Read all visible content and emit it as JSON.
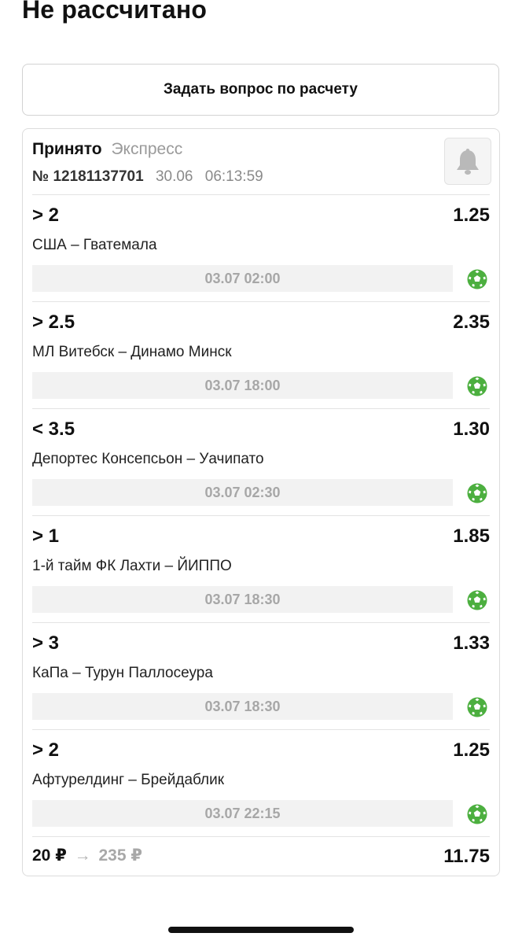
{
  "page_title": "Не рассчитано",
  "ask_button_label": "Задать вопрос по расчету",
  "bet": {
    "status": "Принято",
    "type": "Экспресс",
    "coupon_number": "№ 12181137701",
    "date": "30.06",
    "time": "06:13:59",
    "bell_icon": "bell-icon",
    "events": [
      {
        "outcome": "> 2",
        "odds": "1.25",
        "teams": "США – Гватемала",
        "start": "03.07 02:00",
        "sport_icon": "soccer-ball-icon"
      },
      {
        "outcome": "> 2.5",
        "odds": "2.35",
        "teams": "МЛ Витебск – Динамо Минск",
        "start": "03.07 18:00",
        "sport_icon": "soccer-ball-icon"
      },
      {
        "outcome": "< 3.5",
        "odds": "1.30",
        "teams": "Депортес Консепсьон – Уачипато",
        "start": "03.07 02:30",
        "sport_icon": "soccer-ball-icon"
      },
      {
        "outcome": "> 1",
        "odds": "1.85",
        "teams": "1-й тайм ФК Лахти – ЙИППО",
        "start": "03.07 18:30",
        "sport_icon": "soccer-ball-icon"
      },
      {
        "outcome": "> 3",
        "odds": "1.33",
        "teams": "КаПа – Турун Паллосеура",
        "start": "03.07 18:30",
        "sport_icon": "soccer-ball-icon"
      },
      {
        "outcome": "> 2",
        "odds": "1.25",
        "teams": "Афтурелдинг – Брейдаблик",
        "start": "03.07 22:15",
        "sport_icon": "soccer-ball-icon"
      }
    ],
    "stake": "20 ₽",
    "arrow": "→",
    "payout": "235 ₽",
    "total_odds": "11.75"
  },
  "colors": {
    "accent_green": "#4caf3f",
    "muted_text": "#9a9a9a",
    "time_bg": "#f2f2f2"
  }
}
